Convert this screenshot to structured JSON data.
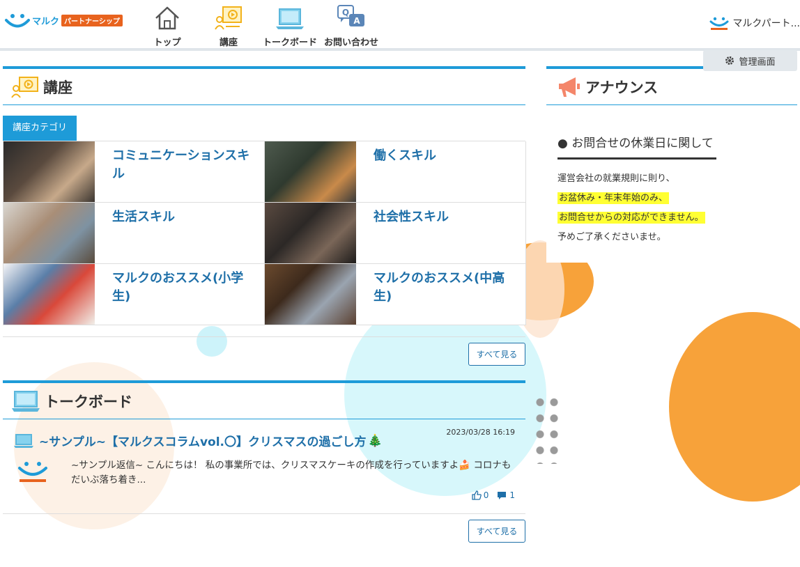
{
  "header": {
    "logo_text": "マルク",
    "logo_badge": "パートナーシップ",
    "nav": [
      {
        "label": "トップ",
        "icon": "home-icon"
      },
      {
        "label": "講座",
        "icon": "course-icon"
      },
      {
        "label": "トークボード",
        "icon": "laptop-icon"
      },
      {
        "label": "お問い合わせ",
        "icon": "qa-icon"
      }
    ],
    "user_name": "マルクパート...",
    "admin_label": "管理画面"
  },
  "courses": {
    "title": "講座",
    "category_label": "講座カテゴリ",
    "categories": [
      {
        "name": "コミュニケーションスキル"
      },
      {
        "name": "働くスキル"
      },
      {
        "name": "生活スキル"
      },
      {
        "name": "社会性スキル"
      },
      {
        "name": "マルクのおススメ(小学生)"
      },
      {
        "name": "マルクのおススメ(中高生)"
      }
    ],
    "see_all": "すべて見る"
  },
  "talkboard": {
    "title": "トークボード",
    "post": {
      "date": "2023/03/28 16:19",
      "title": "~サンプル~【マルクスコラムvol.〇】クリスマスの過ごし方",
      "title_emoji": "🎄",
      "excerpt": "~サンプル返信~ こんにちは！ 私の事業所では、クリスマスケーキの作成を行っていますよ🍰 コロナもだいぶ落ち着き...",
      "likes": "0",
      "comments": "1"
    },
    "see_all": "すべて見る"
  },
  "announce": {
    "title": "アナウンス",
    "item_title": "● お問合せの休業日に関して",
    "lines": [
      {
        "text": "運営会社の就業規則に則り、",
        "highlight": false
      },
      {
        "text": "お盆休み・年末年始のみ、",
        "highlight": true
      },
      {
        "text": "お問合せからの対応ができません。",
        "highlight": true
      },
      {
        "text": "予めご了承くださいませ。",
        "highlight": false
      }
    ]
  },
  "colors": {
    "accent": "#1e9bd8",
    "link": "#1e6fa8",
    "brand_orange": "#e8631e",
    "deco_orange": "#f7a23a",
    "highlight": "#ffff33"
  }
}
